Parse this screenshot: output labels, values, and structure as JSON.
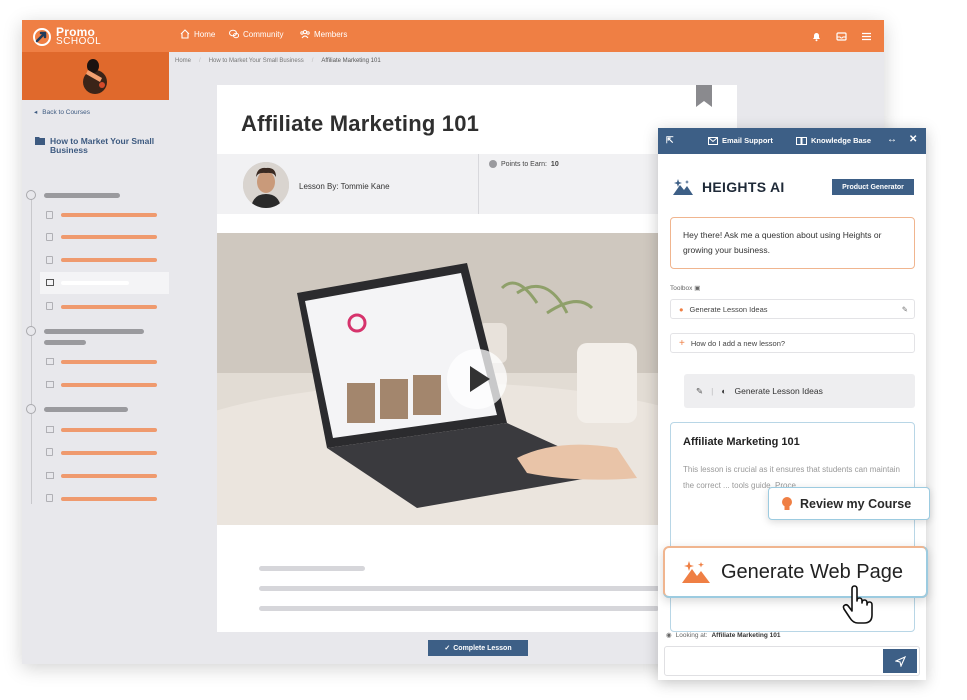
{
  "topbar": {
    "logo_line1": "Promo",
    "logo_line2": "SCHOOL",
    "nav": [
      {
        "label": "Home",
        "icon": "home-icon"
      },
      {
        "label": "Community",
        "icon": "chat-icon"
      },
      {
        "label": "Members",
        "icon": "members-icon"
      }
    ],
    "icons": [
      "bell-icon",
      "inbox-icon",
      "menu-icon"
    ]
  },
  "sidebar": {
    "back_label": "Back to Courses",
    "course_title": "How to Market Your Small Business"
  },
  "breadcrumb": {
    "items": [
      "Home",
      "How to Market Your Small Business",
      "Affiliate Marketing 101"
    ]
  },
  "lesson": {
    "title": "Affiliate Marketing 101",
    "author_label": "Lesson By: Tommie Kane",
    "points_label": "Points to Earn:",
    "points_value": "10",
    "complete_label": "Complete Lesson"
  },
  "ai_panel": {
    "head": {
      "email_support": "Email Support",
      "knowledge_base": "Knowledge Base"
    },
    "brand": "HEIGHTS AI",
    "product_generator": "Product Generator",
    "greeting": "Hey there! Ask me a question about using Heights or growing your business.",
    "toolbox_label": "Toolbox",
    "tool_generate": "Generate Lesson Ideas",
    "tool_question": "How do I add a new lesson?",
    "generating_label": "Generate Lesson Ideas",
    "output_title": "Affiliate Marketing 101",
    "output_body": "This lesson is crucial as it ensures that students can maintain the correct ... tools guide. Proce...",
    "looking_label": "Looking at:",
    "looking_value": "Affiliate Marketing 101"
  },
  "floating": {
    "review": "Review my Course",
    "generate_web": "Generate Web Page"
  },
  "colors": {
    "brand_orange": "#ef7f44",
    "navy": "#3d5f86"
  }
}
